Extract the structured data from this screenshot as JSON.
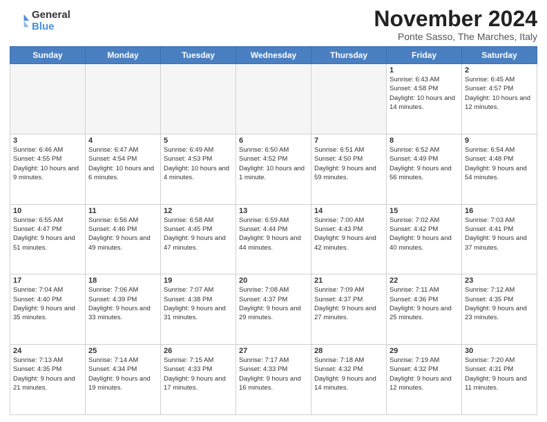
{
  "header": {
    "logo_general": "General",
    "logo_blue": "Blue",
    "month_title": "November 2024",
    "location": "Ponte Sasso, The Marches, Italy"
  },
  "weekdays": [
    "Sunday",
    "Monday",
    "Tuesday",
    "Wednesday",
    "Thursday",
    "Friday",
    "Saturday"
  ],
  "weeks": [
    [
      {
        "day": "",
        "info": ""
      },
      {
        "day": "",
        "info": ""
      },
      {
        "day": "",
        "info": ""
      },
      {
        "day": "",
        "info": ""
      },
      {
        "day": "",
        "info": ""
      },
      {
        "day": "1",
        "info": "Sunrise: 6:43 AM\nSunset: 4:58 PM\nDaylight: 10 hours and 14 minutes."
      },
      {
        "day": "2",
        "info": "Sunrise: 6:45 AM\nSunset: 4:57 PM\nDaylight: 10 hours and 12 minutes."
      }
    ],
    [
      {
        "day": "3",
        "info": "Sunrise: 6:46 AM\nSunset: 4:55 PM\nDaylight: 10 hours and 9 minutes."
      },
      {
        "day": "4",
        "info": "Sunrise: 6:47 AM\nSunset: 4:54 PM\nDaylight: 10 hours and 6 minutes."
      },
      {
        "day": "5",
        "info": "Sunrise: 6:49 AM\nSunset: 4:53 PM\nDaylight: 10 hours and 4 minutes."
      },
      {
        "day": "6",
        "info": "Sunrise: 6:50 AM\nSunset: 4:52 PM\nDaylight: 10 hours and 1 minute."
      },
      {
        "day": "7",
        "info": "Sunrise: 6:51 AM\nSunset: 4:50 PM\nDaylight: 9 hours and 59 minutes."
      },
      {
        "day": "8",
        "info": "Sunrise: 6:52 AM\nSunset: 4:49 PM\nDaylight: 9 hours and 56 minutes."
      },
      {
        "day": "9",
        "info": "Sunrise: 6:54 AM\nSunset: 4:48 PM\nDaylight: 9 hours and 54 minutes."
      }
    ],
    [
      {
        "day": "10",
        "info": "Sunrise: 6:55 AM\nSunset: 4:47 PM\nDaylight: 9 hours and 51 minutes."
      },
      {
        "day": "11",
        "info": "Sunrise: 6:56 AM\nSunset: 4:46 PM\nDaylight: 9 hours and 49 minutes."
      },
      {
        "day": "12",
        "info": "Sunrise: 6:58 AM\nSunset: 4:45 PM\nDaylight: 9 hours and 47 minutes."
      },
      {
        "day": "13",
        "info": "Sunrise: 6:59 AM\nSunset: 4:44 PM\nDaylight: 9 hours and 44 minutes."
      },
      {
        "day": "14",
        "info": "Sunrise: 7:00 AM\nSunset: 4:43 PM\nDaylight: 9 hours and 42 minutes."
      },
      {
        "day": "15",
        "info": "Sunrise: 7:02 AM\nSunset: 4:42 PM\nDaylight: 9 hours and 40 minutes."
      },
      {
        "day": "16",
        "info": "Sunrise: 7:03 AM\nSunset: 4:41 PM\nDaylight: 9 hours and 37 minutes."
      }
    ],
    [
      {
        "day": "17",
        "info": "Sunrise: 7:04 AM\nSunset: 4:40 PM\nDaylight: 9 hours and 35 minutes."
      },
      {
        "day": "18",
        "info": "Sunrise: 7:06 AM\nSunset: 4:39 PM\nDaylight: 9 hours and 33 minutes."
      },
      {
        "day": "19",
        "info": "Sunrise: 7:07 AM\nSunset: 4:38 PM\nDaylight: 9 hours and 31 minutes."
      },
      {
        "day": "20",
        "info": "Sunrise: 7:08 AM\nSunset: 4:37 PM\nDaylight: 9 hours and 29 minutes."
      },
      {
        "day": "21",
        "info": "Sunrise: 7:09 AM\nSunset: 4:37 PM\nDaylight: 9 hours and 27 minutes."
      },
      {
        "day": "22",
        "info": "Sunrise: 7:11 AM\nSunset: 4:36 PM\nDaylight: 9 hours and 25 minutes."
      },
      {
        "day": "23",
        "info": "Sunrise: 7:12 AM\nSunset: 4:35 PM\nDaylight: 9 hours and 23 minutes."
      }
    ],
    [
      {
        "day": "24",
        "info": "Sunrise: 7:13 AM\nSunset: 4:35 PM\nDaylight: 9 hours and 21 minutes."
      },
      {
        "day": "25",
        "info": "Sunrise: 7:14 AM\nSunset: 4:34 PM\nDaylight: 9 hours and 19 minutes."
      },
      {
        "day": "26",
        "info": "Sunrise: 7:15 AM\nSunset: 4:33 PM\nDaylight: 9 hours and 17 minutes."
      },
      {
        "day": "27",
        "info": "Sunrise: 7:17 AM\nSunset: 4:33 PM\nDaylight: 9 hours and 16 minutes."
      },
      {
        "day": "28",
        "info": "Sunrise: 7:18 AM\nSunset: 4:32 PM\nDaylight: 9 hours and 14 minutes."
      },
      {
        "day": "29",
        "info": "Sunrise: 7:19 AM\nSunset: 4:32 PM\nDaylight: 9 hours and 12 minutes."
      },
      {
        "day": "30",
        "info": "Sunrise: 7:20 AM\nSunset: 4:31 PM\nDaylight: 9 hours and 11 minutes."
      }
    ]
  ]
}
